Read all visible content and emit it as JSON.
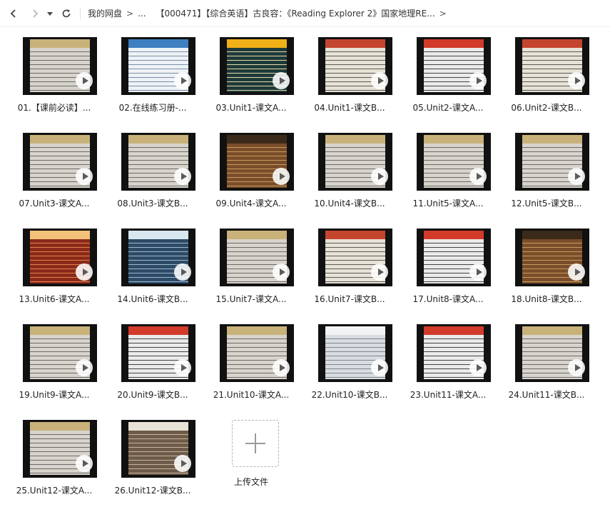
{
  "breadcrumb": {
    "root": "我的网盘",
    "ellipsis": "...",
    "current": "【000471】【综合英语】古良容：《Reading Explorer 2》国家地理RE..."
  },
  "files": [
    {
      "label": "01.【课前必读】...",
      "theme": "doc"
    },
    {
      "label": "02.在线练习册-...",
      "theme": "web"
    },
    {
      "label": "03.Unit1-课文A...",
      "theme": "yellow"
    },
    {
      "label": "04.Unit1-课文B...",
      "theme": "book"
    },
    {
      "label": "05.Unit2-课文A...",
      "theme": "redtext"
    },
    {
      "label": "06.Unit2-课文B...",
      "theme": "book"
    },
    {
      "label": "07.Unit3-课文A...",
      "theme": "doc"
    },
    {
      "label": "08.Unit3-课文B...",
      "theme": "doc"
    },
    {
      "label": "09.Unit4-课文A...",
      "theme": "photo"
    },
    {
      "label": "10.Unit4-课文B...",
      "theme": "doc"
    },
    {
      "label": "11.Unit5-课文A...",
      "theme": "doc"
    },
    {
      "label": "12.Unit5-课文B...",
      "theme": "doc"
    },
    {
      "label": "13.Unit6-课文A...",
      "theme": "red"
    },
    {
      "label": "14.Unit6-课文B...",
      "theme": "blue"
    },
    {
      "label": "15.Unit7-课文A...",
      "theme": "doc"
    },
    {
      "label": "16.Unit7-课文B...",
      "theme": "book"
    },
    {
      "label": "17.Unit8-课文A...",
      "theme": "redtext"
    },
    {
      "label": "18.Unit8-课文B...",
      "theme": "photo"
    },
    {
      "label": "19.Unit9-课文A...",
      "theme": "doc"
    },
    {
      "label": "20.Unit9-课文B...",
      "theme": "redtext"
    },
    {
      "label": "21.Unit10-课文A...",
      "theme": "doc"
    },
    {
      "label": "22.Unit10-课文B...",
      "theme": "ice"
    },
    {
      "label": "23.Unit11-课文A...",
      "theme": "redtext"
    },
    {
      "label": "24.Unit11-课文B...",
      "theme": "doc"
    },
    {
      "label": "25.Unit12-课文A...",
      "theme": "doc"
    },
    {
      "label": "26.Unit12-课文B...",
      "theme": "shark"
    }
  ],
  "upload": {
    "label": "上传文件"
  },
  "colors": {
    "text": "#222222",
    "border": "#eeeeee",
    "upload_dash": "#b5b5b5"
  },
  "icons": {
    "back": "chevron-left-icon",
    "forward": "chevron-right-icon",
    "history": "caret-down-icon",
    "refresh": "refresh-icon",
    "play": "play-icon",
    "upload": "plus-icon"
  }
}
